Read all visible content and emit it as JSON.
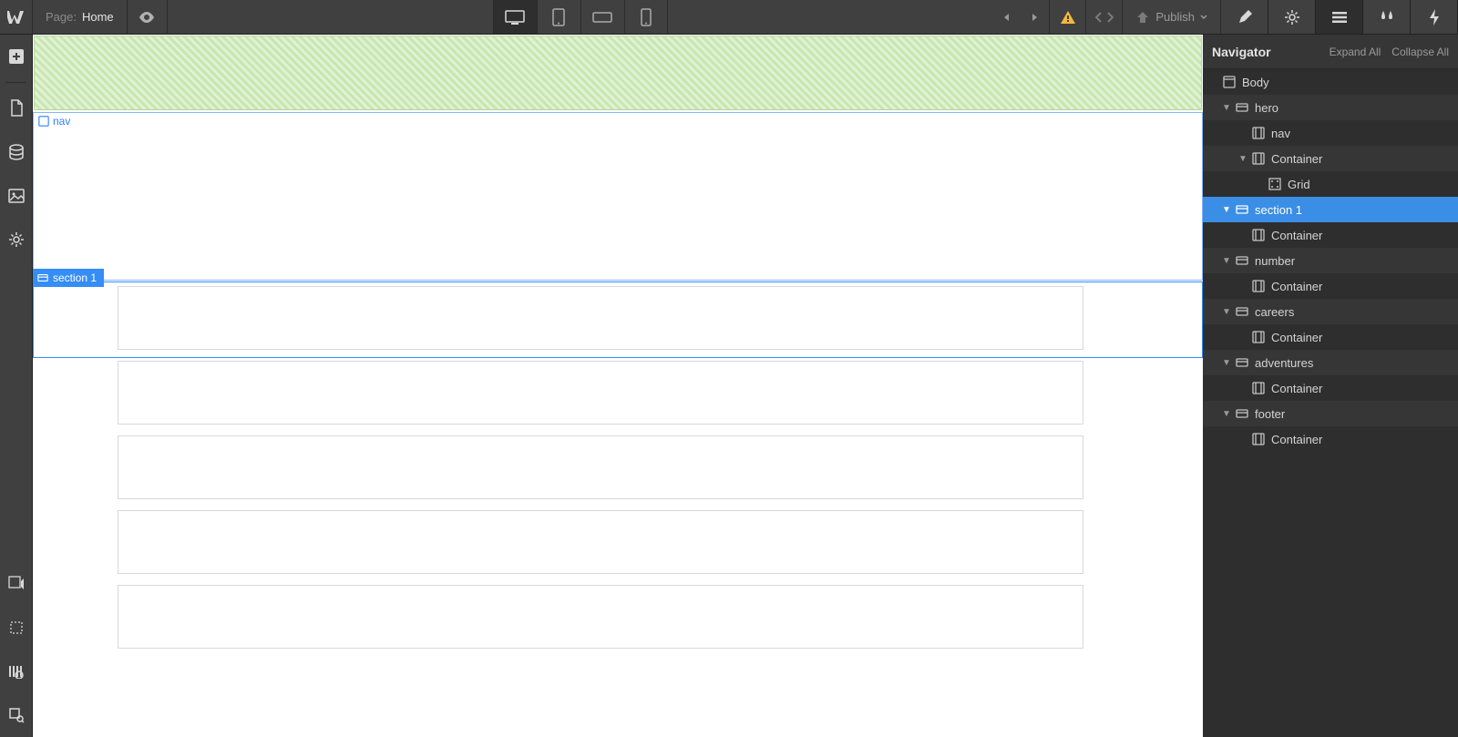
{
  "topbar": {
    "page_label": "Page:",
    "page_name": "Home",
    "publish_label": "Publish"
  },
  "canvas": {
    "nav_label": "nav",
    "section1_label": "section 1"
  },
  "navigator": {
    "title": "Navigator",
    "expand_label": "Expand All",
    "collapse_label": "Collapse All",
    "tree": [
      {
        "label": "Body",
        "icon": "body",
        "indent": 0,
        "toggle": false,
        "alt": false
      },
      {
        "label": "hero",
        "icon": "section",
        "indent": 1,
        "toggle": true,
        "alt": true
      },
      {
        "label": "nav",
        "icon": "container",
        "indent": 2,
        "toggle": false,
        "alt": false
      },
      {
        "label": "Container",
        "icon": "container",
        "indent": 2,
        "toggle": true,
        "alt": true
      },
      {
        "label": "Grid",
        "icon": "grid",
        "indent": 3,
        "toggle": false,
        "alt": false
      },
      {
        "label": "section 1",
        "icon": "section",
        "indent": 1,
        "toggle": true,
        "alt": false,
        "selected": true
      },
      {
        "label": "Container",
        "icon": "container",
        "indent": 2,
        "toggle": false,
        "alt": false
      },
      {
        "label": "number",
        "icon": "section",
        "indent": 1,
        "toggle": true,
        "alt": true
      },
      {
        "label": "Container",
        "icon": "container",
        "indent": 2,
        "toggle": false,
        "alt": false
      },
      {
        "label": "careers",
        "icon": "section",
        "indent": 1,
        "toggle": true,
        "alt": true
      },
      {
        "label": "Container",
        "icon": "container",
        "indent": 2,
        "toggle": false,
        "alt": false
      },
      {
        "label": "adventures",
        "icon": "section",
        "indent": 1,
        "toggle": true,
        "alt": true
      },
      {
        "label": "Container",
        "icon": "container",
        "indent": 2,
        "toggle": false,
        "alt": false
      },
      {
        "label": "footer",
        "icon": "section",
        "indent": 1,
        "toggle": true,
        "alt": true
      },
      {
        "label": "Container",
        "icon": "container",
        "indent": 2,
        "toggle": false,
        "alt": false
      }
    ]
  }
}
